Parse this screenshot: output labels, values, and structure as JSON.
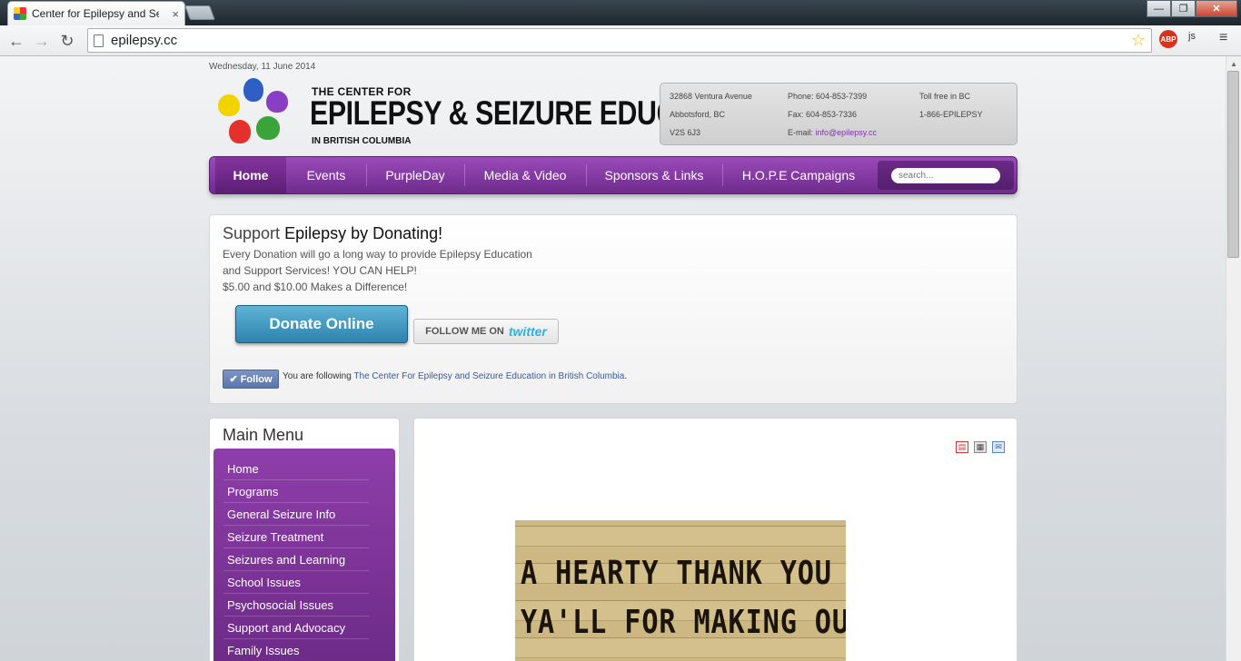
{
  "browser": {
    "tab_title": "Center for Epilepsy and Se",
    "tab_close": "×",
    "url": "epilepsy.cc",
    "window_buttons": {
      "minimize": "—",
      "maximize": "❐",
      "close": "✕"
    },
    "nav_icons": {
      "back": "←",
      "forward": "→",
      "reload": "↻"
    },
    "star_icon": "☆",
    "abp_label": "ABP",
    "js_label": "js",
    "menu_icon": "≡"
  },
  "page": {
    "date": "Wednesday, 11 June 2014",
    "logo": {
      "line1": "THE CENTER FOR",
      "line2": "EPILEPSY & SEIZURE EDUCATION",
      "line3": "IN BRITISH COLUMBIA"
    },
    "contact": {
      "address1": "32868 Ventura Avenue",
      "address2": "Abbotsford, BC",
      "address3": "V2S 6J3",
      "phone": "Phone: 604-853-7399",
      "fax": "Fax: 604-853-7336",
      "email_label": "E-mail:",
      "email": "info@epilepsy.cc",
      "tollfree_label": "Toll free in BC",
      "tollfree": "1-866-EPILEPSY"
    },
    "nav": {
      "items": [
        "Home",
        "Events",
        "PurpleDay",
        "Media & Video",
        "Sponsors & Links",
        "H.O.P.E Campaigns"
      ],
      "search_placeholder": "search..."
    },
    "donate": {
      "title_prefix": "Support",
      "title_rest": "Epilepsy by Donating!",
      "line1": "Every Donation will go a long way to provide Epilepsy Education",
      "line2": "and Support Services! YOU CAN HELP!",
      "line3": "$5.00 and $10.00 Makes a Difference!",
      "button": "Donate Online",
      "twitter_prefix": "FOLLOW ME ON",
      "twitter_word": "twitter",
      "follow_button": "✔ Follow",
      "follow_text": "You are following",
      "follow_link": "The Center For Epilepsy and Seizure Education in British Columbia",
      "follow_end": "."
    },
    "sidebar": {
      "title": "Main Menu",
      "items": [
        "Home",
        "Programs",
        "General Seizure Info",
        "Seizure Treatment",
        "Seizures and Learning",
        "School Issues",
        "Psychosocial Issues",
        "Support and Advocacy",
        "Family Issues"
      ]
    },
    "content": {
      "image_line1": "A HEARTY THANK YOU TO",
      "image_line2": "YA'LL FOR MAKING OUR"
    }
  },
  "colors": {
    "brand_purple": "#7a34a3",
    "donate_blue": "#2d83ad",
    "twitter_blue": "#29b1e8"
  }
}
